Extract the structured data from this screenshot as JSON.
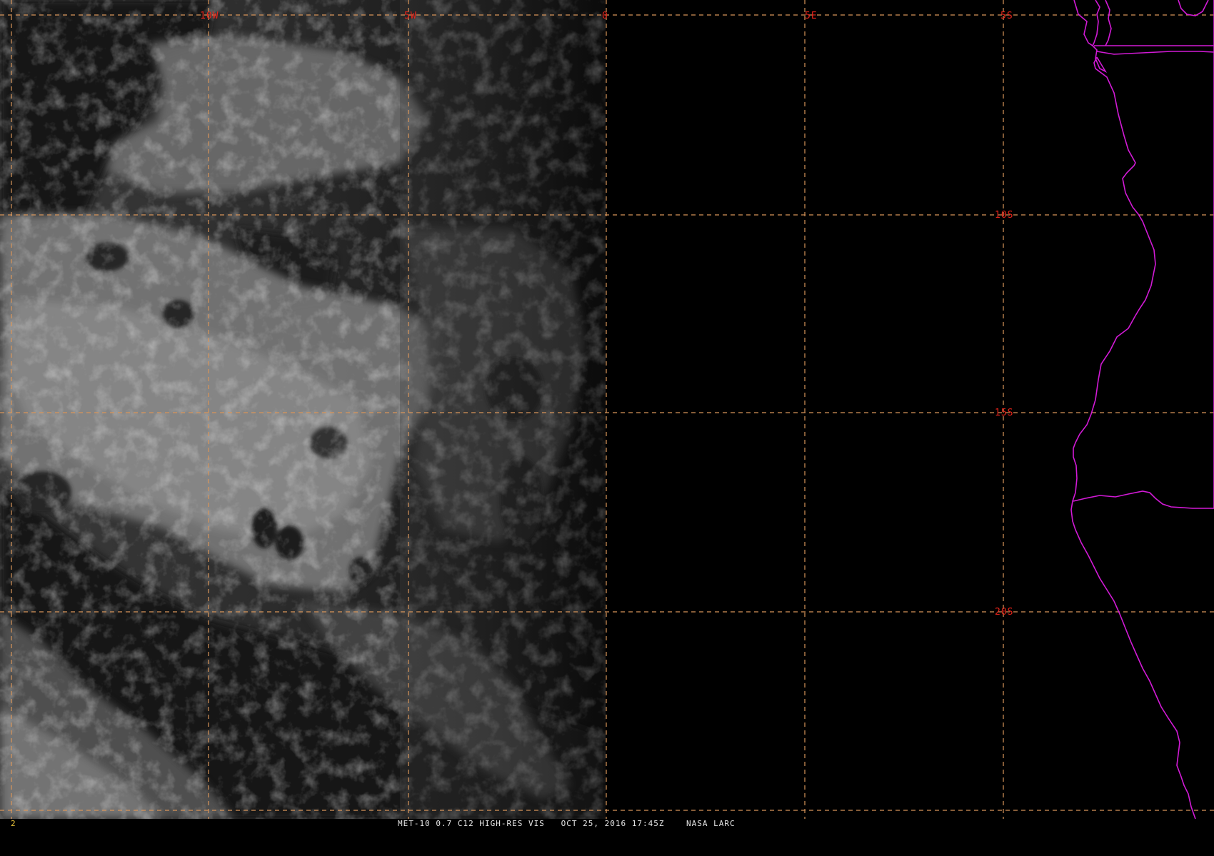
{
  "image": {
    "caption": "MET-10 0.7 C12 HIGH-RES VIS   OCT 25, 2016 17:45Z    NASA LARC",
    "frame_number": "2"
  },
  "grid": {
    "line_color": "#d8955a",
    "label_color": "#e8241a",
    "longitude_labels": [
      "10W",
      "5W",
      "0",
      "5E"
    ],
    "latitude_labels": [
      "5S",
      "10S",
      "15S",
      "20S"
    ]
  },
  "borders": {
    "color": "#d21ad6"
  }
}
